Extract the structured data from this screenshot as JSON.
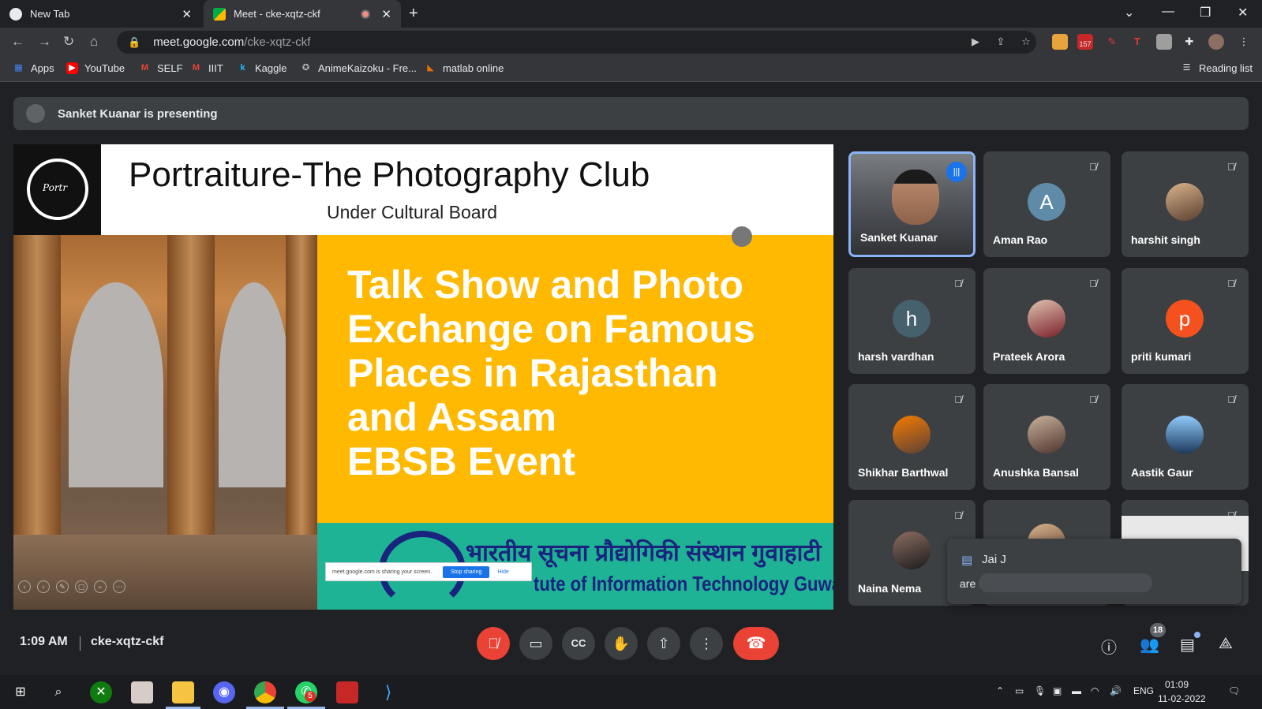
{
  "browser": {
    "tabs": [
      {
        "title": "New Tab",
        "active": false
      },
      {
        "title": "Meet - cke-xqtz-ckf",
        "active": true
      }
    ],
    "new_tab_label": "+",
    "url_host": "meet.google.com",
    "url_path": "/cke-xqtz-ckf",
    "extension_badge": "157",
    "reading_list_label": "Reading list",
    "bookmarks": [
      {
        "label": "Apps",
        "icon": "apps-grid-icon"
      },
      {
        "label": "YouTube",
        "icon": "youtube-icon"
      },
      {
        "label": "SELF",
        "icon": "gmail-icon"
      },
      {
        "label": "IIIT",
        "icon": "gmail-icon"
      },
      {
        "label": "Kaggle",
        "icon": "kaggle-icon"
      },
      {
        "label": "AnimeKaizoku - Fre...",
        "icon": "animekaizoku-icon"
      },
      {
        "label": "matlab online",
        "icon": "matlab-icon"
      }
    ]
  },
  "meet": {
    "presenting_text": "Sanket Kuanar is presenting",
    "slide": {
      "logo_text": "Portr",
      "title": "Portraiture-The Photography Club",
      "subtitle": "Under Cultural Board",
      "lines": [
        "Talk Show and Photo",
        "Exchange on Famous",
        "Places in Rajasthan",
        "and Assam",
        "EBSB Event"
      ],
      "institute_hindi": "भारतीय सूचना प्रौद्योगिकी संस्थान गुवाहाटी",
      "institute_english": "tute of Information Technology Guwahati",
      "share_banner": {
        "text": "meet.google.com is sharing your screen.",
        "stop_label": "Stop sharing",
        "hide_label": "Hide"
      }
    },
    "participants": [
      {
        "name": "Sanket Kuanar",
        "type": "video",
        "speaking": true
      },
      {
        "name": "Aman Rao",
        "type": "letter",
        "letter": "A",
        "color": "#5f8ba8",
        "muted": true
      },
      {
        "name": "harshit singh",
        "type": "photo",
        "muted": true
      },
      {
        "name": "harsh vardhan",
        "type": "letter",
        "letter": "h",
        "color": "#45616e",
        "muted": true
      },
      {
        "name": "Prateek Arora",
        "type": "photo",
        "muted": true
      },
      {
        "name": "priti kumari",
        "type": "letter",
        "letter": "p",
        "color": "#f4511e",
        "muted": true
      },
      {
        "name": "Shikhar Barthwal",
        "type": "photo",
        "muted": true
      },
      {
        "name": "Anushka Bansal",
        "type": "photo",
        "muted": true
      },
      {
        "name": "Aastik Gaur",
        "type": "photo",
        "muted": true
      },
      {
        "name": "Naina Nema",
        "type": "photo",
        "muted": true
      }
    ],
    "chat_popup": {
      "sender": "Jai J",
      "message": "are"
    },
    "time": "1:09 AM",
    "meeting_code": "cke-xqtz-ckf",
    "people_count": "18"
  },
  "taskbar": {
    "lang": "ENG",
    "time": "01:09",
    "date": "11-02-2022",
    "whatsapp_badge": "5"
  },
  "colors": {
    "meet_bg": "#202124",
    "tile_bg": "#3c4043",
    "end_call": "#ea4335",
    "active_border": "#8ab4f8",
    "slide_yellow": "#ffb900",
    "slide_teal": "#1fb396"
  }
}
